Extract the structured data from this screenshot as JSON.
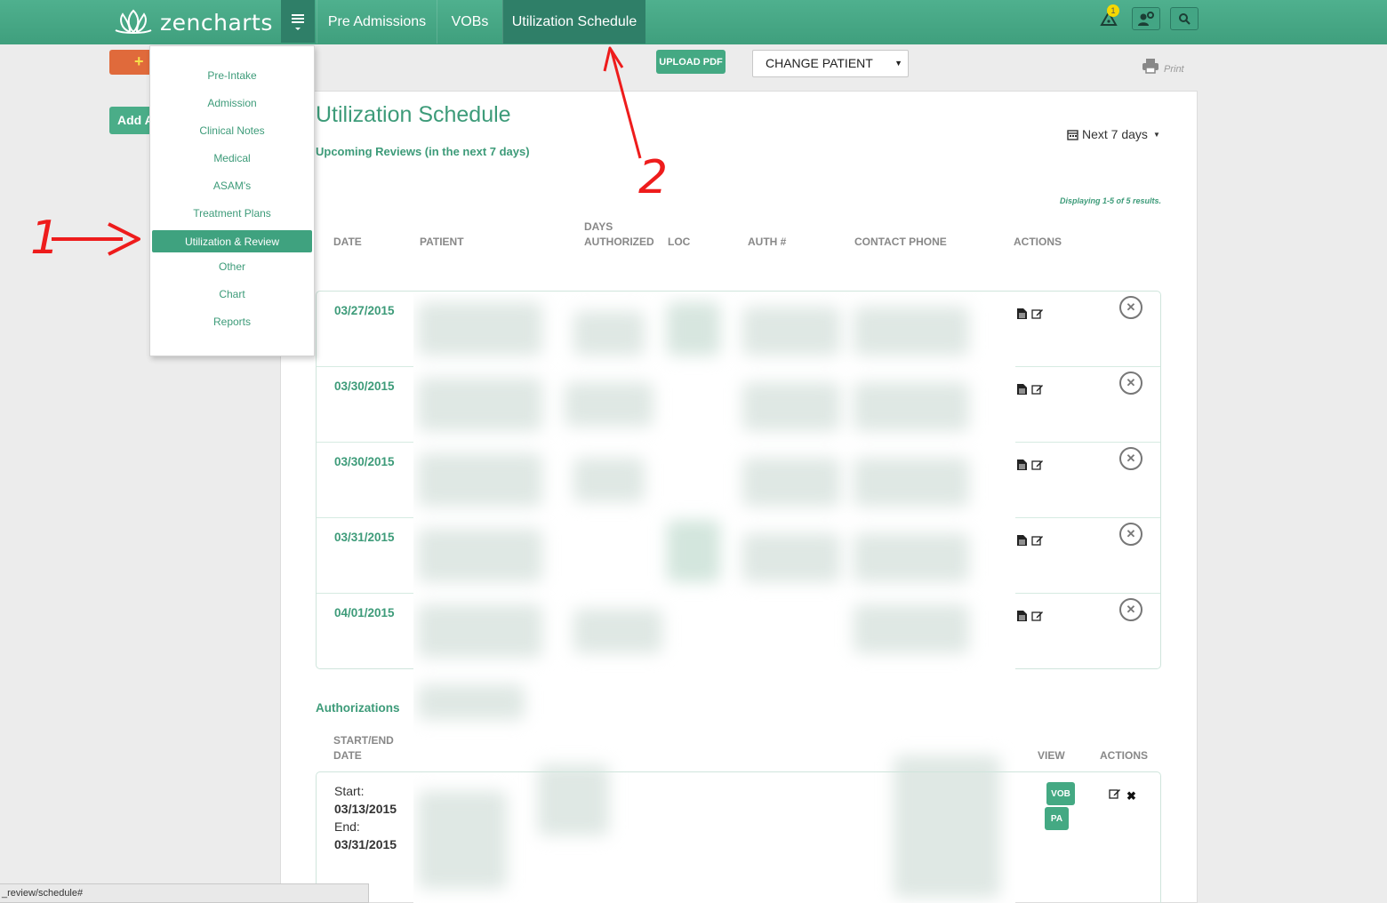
{
  "brand": {
    "name": "zencharts"
  },
  "nav": {
    "tabs": [
      {
        "label": "Pre Admissions"
      },
      {
        "label": "VOBs"
      },
      {
        "label": "Utilization Schedule",
        "active": true
      }
    ],
    "notification_count": "1"
  },
  "sidebar": {
    "add_button_label": "+",
    "add_auth_label": "Add Au"
  },
  "menu": {
    "items": [
      {
        "label": "Pre-Intake"
      },
      {
        "label": "Admission"
      },
      {
        "label": "Clinical Notes"
      },
      {
        "label": "Medical"
      },
      {
        "label": "ASAM's"
      },
      {
        "label": "Treatment Plans"
      },
      {
        "label": "Utilization & Review",
        "active": true
      },
      {
        "label": "Other"
      },
      {
        "label": "Chart"
      },
      {
        "label": "Reports"
      }
    ]
  },
  "toolbar": {
    "upload_label": "UPLOAD PDF",
    "patient_select_label": "CHANGE PATIENT",
    "print_label": "Print"
  },
  "page": {
    "title": "Utilization Schedule",
    "subtitle": "Upcoming Reviews (in the next 7 days)",
    "range_label": "Next 7 days",
    "results_label": "Displaying 1-5 of 5 results."
  },
  "reviews_table": {
    "columns": [
      "DATE",
      "PATIENT",
      "DAYS AUTHORIZED",
      "LOC",
      "AUTH #",
      "CONTACT PHONE",
      "ACTIONS"
    ],
    "rows": [
      {
        "date": "03/27/2015"
      },
      {
        "date": "03/30/2015"
      },
      {
        "date": "03/30/2015"
      },
      {
        "date": "03/31/2015"
      },
      {
        "date": "04/01/2015"
      }
    ]
  },
  "authorizations": {
    "title": "Authorizations",
    "columns": {
      "start_end": "START/END DATE",
      "view": "VIEW",
      "actions": "ACTIONS"
    },
    "rows": [
      {
        "start_label": "Start:",
        "start": "03/13/2015",
        "end_label": "End:",
        "end": "03/31/2015",
        "view_buttons": [
          "VOB",
          "PA"
        ]
      }
    ]
  },
  "annotations": {
    "one": "1",
    "two": "2"
  },
  "statusbar": {
    "url": "_review/schedule#"
  },
  "colors": {
    "brand_green": "#3f9f7d",
    "dark_green": "#2f7f68",
    "accent_orange": "#e06a3b",
    "annotation_red": "#ee1c1c"
  }
}
